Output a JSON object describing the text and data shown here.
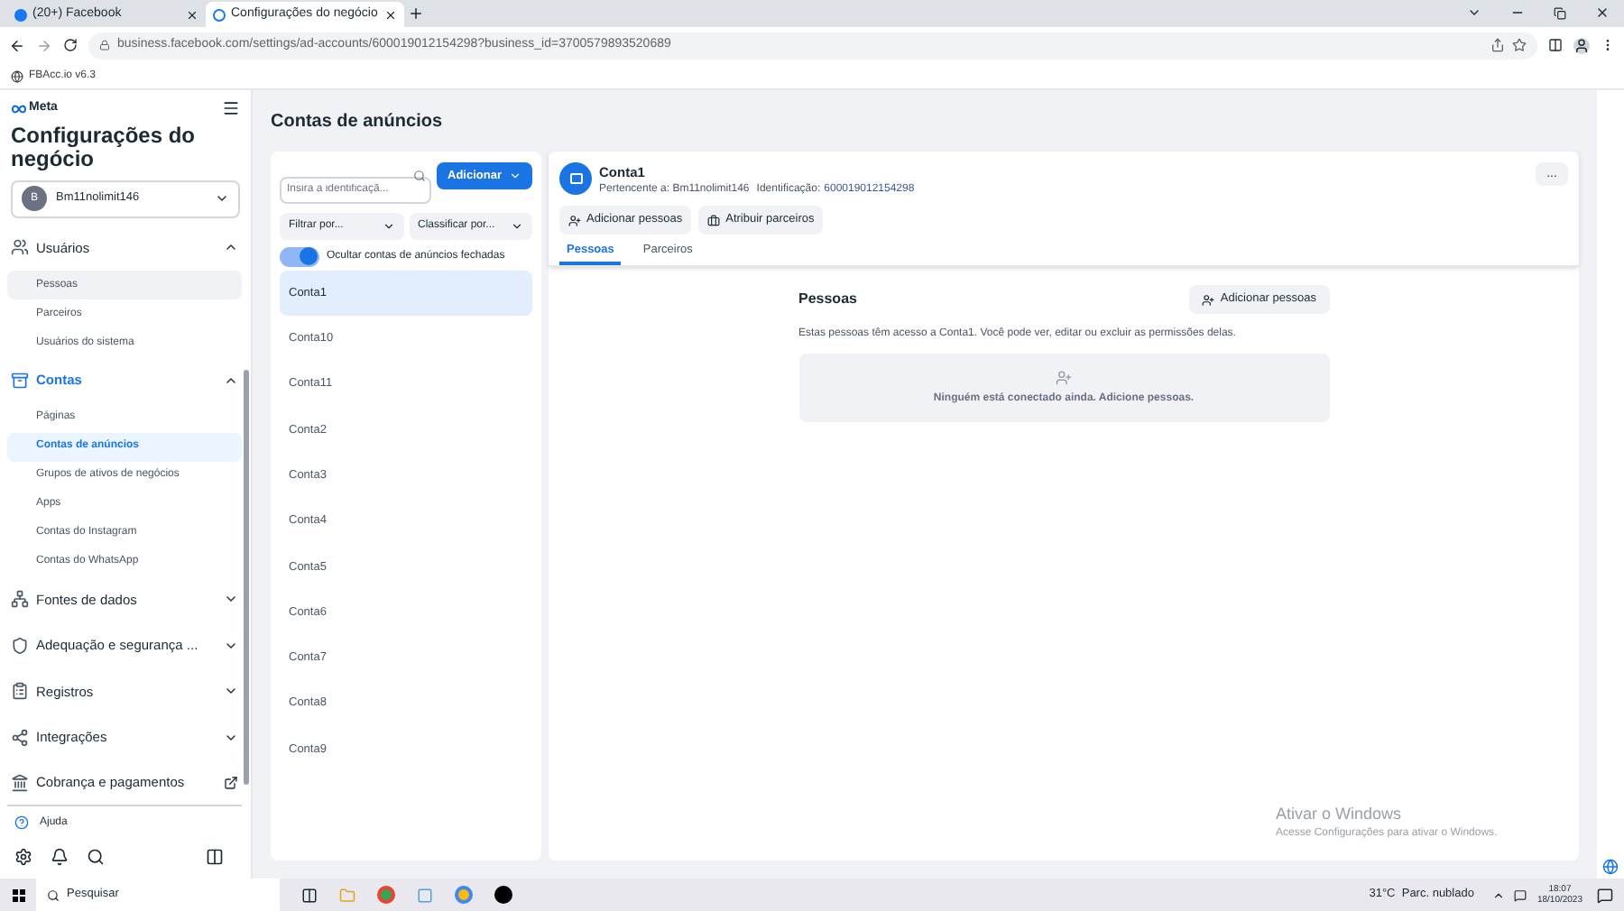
{
  "browser": {
    "tabs": [
      {
        "title": "(20+) Facebook",
        "selected": false
      },
      {
        "title": "Configurações do negócio",
        "selected": true
      }
    ],
    "url": "business.facebook.com/settings/ad-accounts/600019012154298?business_id=3700579893520689",
    "bookmarks": [
      "FBAcc.io v6.3"
    ]
  },
  "sidebar": {
    "brand": "Meta",
    "title": "Configurações do negócio",
    "business": {
      "initial": "B",
      "name": "Bm11nolimit146"
    },
    "sections": [
      {
        "label": "Usuários",
        "expanded": true,
        "active": false,
        "children": [
          {
            "label": "Pessoas",
            "selected": false,
            "hovered": true
          },
          {
            "label": "Parceiros",
            "selected": false,
            "hovered": false
          },
          {
            "label": "Usuários do sistema",
            "selected": false,
            "hovered": false
          }
        ]
      },
      {
        "label": "Contas",
        "expanded": true,
        "active": true,
        "children": [
          {
            "label": "Páginas",
            "selected": false,
            "hovered": false
          },
          {
            "label": "Contas de anúncios",
            "selected": true,
            "hovered": false
          },
          {
            "label": "Grupos de ativos de negócios",
            "selected": false,
            "hovered": false
          },
          {
            "label": "Apps",
            "selected": false,
            "hovered": false
          },
          {
            "label": "Contas do Instagram",
            "selected": false,
            "hovered": false
          },
          {
            "label": "Contas do WhatsApp",
            "selected": false,
            "hovered": false
          }
        ]
      },
      {
        "label": "Fontes de dados",
        "expanded": false,
        "active": false
      },
      {
        "label": "Adequação e segurança ...",
        "expanded": false,
        "active": false
      },
      {
        "label": "Registros",
        "expanded": false,
        "active": false
      },
      {
        "label": "Integrações",
        "expanded": false,
        "active": false
      },
      {
        "label": "Cobrança e pagamentos",
        "active": false
      }
    ],
    "help": "Ajuda"
  },
  "page": {
    "title": "Contas de anúncios",
    "search": {
      "placeholder": "Insira a identificaçã..."
    },
    "add_button": "Adicionar",
    "filter": "Filtrar por...",
    "sort": "Classificar por...",
    "hide_closed": {
      "label": "Ocultar contas de anúncios fechadas",
      "on": true
    },
    "accounts": [
      {
        "name": "Conta1",
        "selected": true
      },
      {
        "name": "Conta10",
        "selected": false
      },
      {
        "name": "Conta11",
        "selected": false
      },
      {
        "name": "Conta2",
        "selected": false
      },
      {
        "name": "Conta3",
        "selected": false
      },
      {
        "name": "Conta4",
        "selected": false
      },
      {
        "name": "Conta5",
        "selected": false
      },
      {
        "name": "Conta6",
        "selected": false
      },
      {
        "name": "Conta7",
        "selected": false
      },
      {
        "name": "Conta8",
        "selected": false
      },
      {
        "name": "Conta9",
        "selected": false
      }
    ],
    "detail": {
      "name": "Conta1",
      "owner_label": "Pertencente a: Bm11nolimit146",
      "id_label": "Identificação:",
      "id": "600019012154298",
      "actions": [
        "Adicionar pessoas",
        "Atribuir parceiros"
      ],
      "more": "...",
      "tabs": [
        {
          "label": "Pessoas",
          "selected": true
        },
        {
          "label": "Parceiros",
          "selected": false
        }
      ],
      "people": {
        "title": "Pessoas",
        "add_button": "Adicionar pessoas",
        "description": "Estas pessoas têm acesso a Conta1. Você pode ver, editar ou excluir as permissões delas.",
        "empty": "Ninguém está conectado ainda. Adicione pessoas."
      }
    }
  },
  "windows_notice": {
    "title": "Ativar o Windows",
    "text": "Acesse Configurações para ativar o Windows."
  },
  "taskbar": {
    "search": "Pesquisar",
    "weather": "31°C  Parc. nublado",
    "time": "18:07",
    "date": "18/10/2023"
  }
}
